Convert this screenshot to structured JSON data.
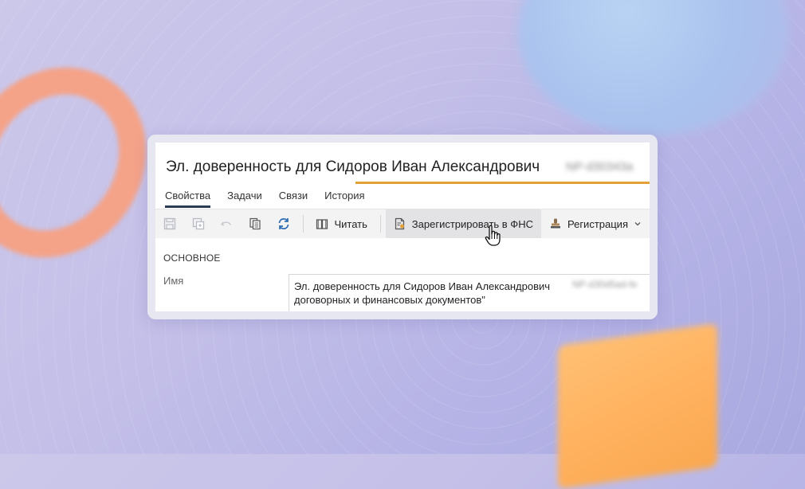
{
  "window": {
    "title": "Эл. доверенность для Сидоров Иван Александрович",
    "title_extra_blurred": "NP-d30343a"
  },
  "tabs": [
    {
      "label": "Свойства",
      "active": true
    },
    {
      "label": "Задачи",
      "active": false
    },
    {
      "label": "Связи",
      "active": false
    },
    {
      "label": "История",
      "active": false
    }
  ],
  "toolbar": {
    "save_icon": "save-icon",
    "save_as_icon": "save-as-icon",
    "undo_icon": "undo-icon",
    "copy_icon": "copy-icon",
    "refresh_icon": "refresh-icon",
    "read_label": "Читать",
    "register_fns_label": "Зарегистрировать в ФНС",
    "registration_label": "Регистрация"
  },
  "section": {
    "title": "ОСНОВНОЕ"
  },
  "fields": {
    "name_label": "Имя",
    "name_value_line1": "Эл. доверенность для Сидоров Иван Александрович",
    "name_value_line2": "договорных и финансовых документов\"",
    "name_value_blurred": "NP-d30d5ad-fe"
  },
  "colors": {
    "accent": "#e3a038",
    "active_tab_underline": "#2a3a55",
    "refresh_icon": "#2f6fb3"
  }
}
